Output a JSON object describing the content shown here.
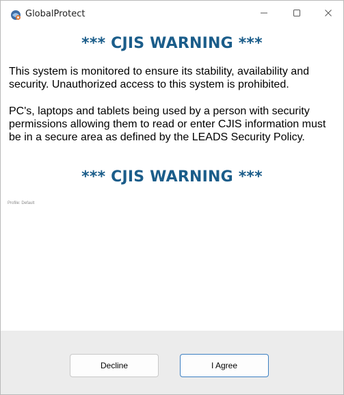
{
  "window": {
    "title": "GlobalProtect",
    "controls": {
      "minimize": "—",
      "maximize": "☐",
      "close": "✕"
    }
  },
  "banner": {
    "heading": "*** CJIS WARNING ***",
    "paragraph1": "This system is monitored to ensure its stability, availability and security. Unauthorized access to this system is prohibited.",
    "paragraph2": "PC's, laptops and tablets being used by a person with security permissions allowing them to read or enter CJIS information must be in a secure area as defined by the LEADS Security Policy.",
    "footer_heading": "*** CJIS WARNING ***"
  },
  "profile_label": "Profile: Default",
  "buttons": {
    "decline": "Decline",
    "agree": "I Agree"
  },
  "colors": {
    "heading": "#1b5d8a",
    "footer_bg": "#ececec",
    "agree_border": "#3c7fc1"
  },
  "icons": {
    "app": "globalprotect-icon"
  }
}
